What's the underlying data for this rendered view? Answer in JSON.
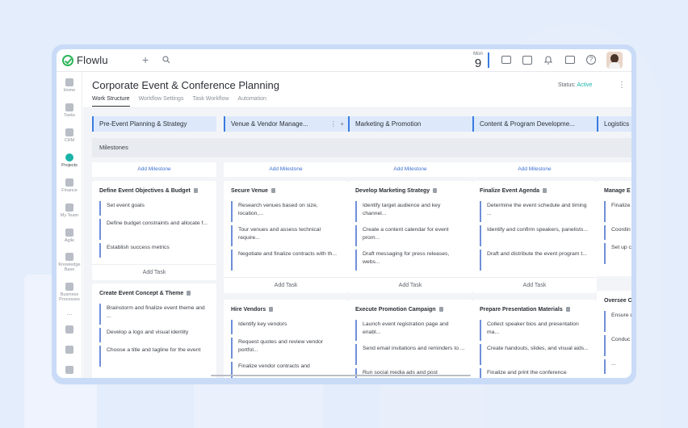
{
  "app": {
    "name": "Flowlu"
  },
  "topbar": {
    "date_month": "Mon",
    "date_day": "9"
  },
  "sidebar": {
    "items": [
      {
        "label": "Home",
        "icon": "home-icon"
      },
      {
        "label": "Tasks",
        "icon": "tasks-icon"
      },
      {
        "label": "CRM",
        "icon": "crm-icon"
      },
      {
        "label": "Projects",
        "icon": "projects-icon"
      },
      {
        "label": "Finance",
        "icon": "finance-icon"
      },
      {
        "label": "My Team",
        "icon": "team-icon"
      },
      {
        "label": "Agile",
        "icon": "agile-icon"
      },
      {
        "label": "Knowledge Base",
        "icon": "knowledge-base-icon"
      },
      {
        "label": "Business Processes",
        "icon": "business-processes-icon"
      },
      {
        "label": "...",
        "icon": "more-icon"
      }
    ]
  },
  "page": {
    "title": "Corporate Event & Conference Planning",
    "status_label": "Status:",
    "status_value": "Active",
    "tabs": [
      "Work Structure",
      "Workflow Settings",
      "Task Workflow",
      "Automation"
    ]
  },
  "board": {
    "milestones_label": "Milestones",
    "add_milestone": "Add Milestone",
    "add_task": "Add Task",
    "columns": [
      {
        "name": "Pre-Event Planning & Strategy",
        "cards": [
          {
            "title": "Define Event Objectives & Budget",
            "tasks": [
              "Set event goals",
              "Define budget constraints and allocate f...",
              "Establish success metrics"
            ]
          },
          {
            "title": "Create Event Concept & Theme",
            "tasks": [
              "Brainstorm and finalize event theme and ...",
              "Develop a logo and visual identity",
              "Choose a title and tagline for the event"
            ]
          }
        ]
      },
      {
        "name": "Venue & Vendor Manage...",
        "cards": [
          {
            "title": "Secure Venue",
            "tasks": [
              "Research venues based on size, location,...",
              "Tour venues and assess technical require...",
              "Negotiate and finalize contracts with th..."
            ]
          },
          {
            "title": "Hire Vendors",
            "tasks": [
              "Identify key vendors",
              "Request quotes and review vendor portfol...",
              "Finalize vendor contracts and"
            ]
          }
        ]
      },
      {
        "name": "Marketing & Promotion",
        "cards": [
          {
            "title": "Develop Marketing Strategy",
            "tasks": [
              "Identify target audience and key channel...",
              "Create a content calendar for event prom...",
              "Draft messaging for press releases, webs..."
            ]
          },
          {
            "title": "Execute Promotion Campaign",
            "tasks": [
              "Launch event registration page and enabl...",
              "Send email invitations and reminders to ...",
              "Run social media ads and post"
            ]
          }
        ]
      },
      {
        "name": "Content & Program Developme...",
        "cards": [
          {
            "title": "Finalize Event Agenda",
            "tasks": [
              "Determine the event schedule and timing ...",
              "Identify and confirm speakers, panelists...",
              "Draft and distribute the event program t..."
            ]
          },
          {
            "title": "Prepare Presentation Materials",
            "tasks": [
              "Collect speaker bios and presentation ma...",
              "Create handouts, slides, and visual aids...",
              "Finalize and print the conference"
            ]
          }
        ]
      },
      {
        "name": "Logistics",
        "cards": [
          {
            "title": "Manage E",
            "tasks": [
              "Finalize and s...",
              "Coordin",
              "Set up c layouts"
            ]
          },
          {
            "title": "Oversee C",
            "tasks": [
              "Ensure duties",
              "Conduc all st...",
              "..."
            ]
          }
        ]
      }
    ]
  },
  "colors": {
    "accent": "#3a7be0",
    "active": "#1bb3a8",
    "brand": "#2fb55a"
  }
}
